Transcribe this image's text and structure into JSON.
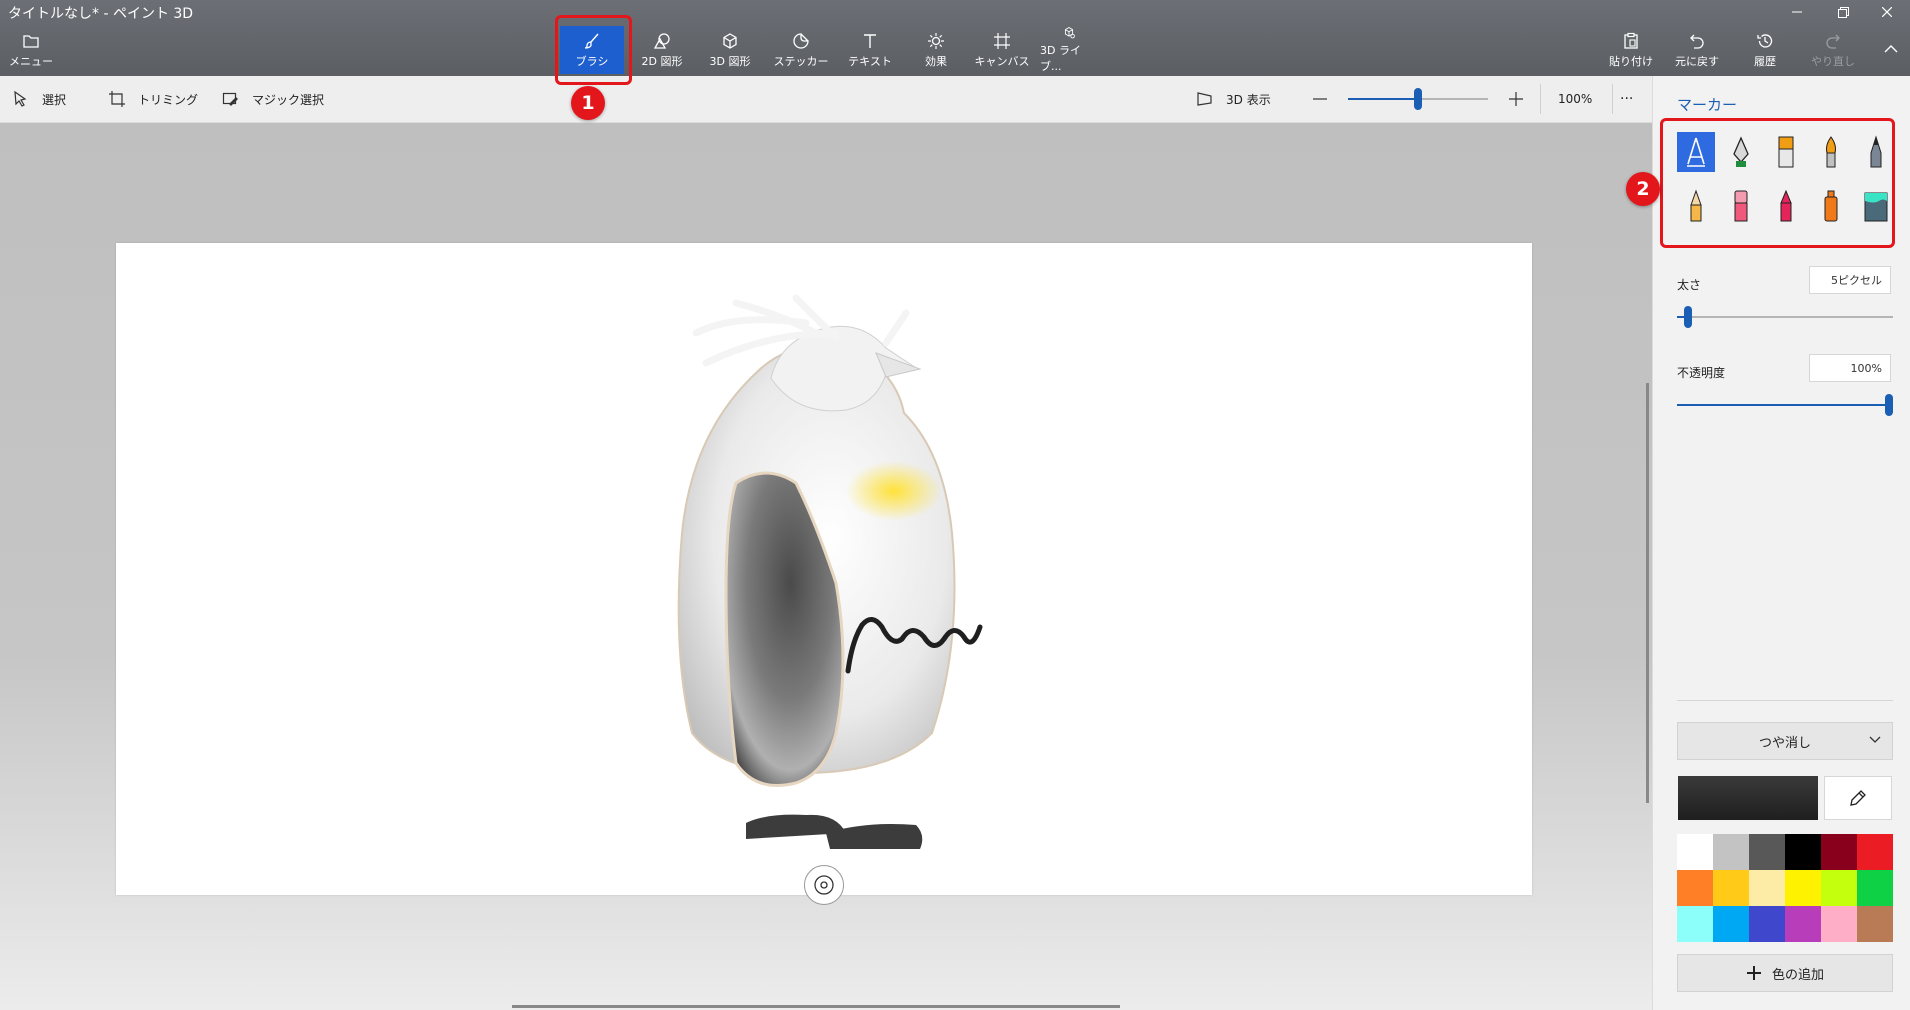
{
  "window": {
    "title": "タイトルなし* - ペイント 3D",
    "controls": [
      "minimize-icon",
      "restore-icon",
      "close-icon"
    ]
  },
  "ribbon": {
    "menu_label": "メニュー",
    "tools": [
      {
        "label": "ブラシ",
        "icon": "brush-icon",
        "active": true
      },
      {
        "label": "2D 図形",
        "icon": "2d-shapes-icon"
      },
      {
        "label": "3D 図形",
        "icon": "3d-shapes-icon"
      },
      {
        "label": "ステッカー",
        "icon": "stickers-icon"
      },
      {
        "label": "テキスト",
        "icon": "text-icon"
      },
      {
        "label": "効果",
        "icon": "effects-icon"
      },
      {
        "label": "キャンバス",
        "icon": "canvas-icon"
      },
      {
        "label": "3D ライブ...",
        "icon": "3d-library-icon"
      }
    ],
    "right": [
      {
        "label": "貼り付け",
        "icon": "paste-icon"
      },
      {
        "label": "元に戻す",
        "icon": "undo-icon"
      },
      {
        "label": "履歴",
        "icon": "history-icon"
      },
      {
        "label": "やり直し",
        "icon": "redo-icon",
        "disabled": true
      }
    ]
  },
  "subtoolbar": {
    "select": "選択",
    "crop": "トリミング",
    "magic_select": "マジック選択",
    "view3d": "3D 表示",
    "zoom": "100%",
    "zoom_level": 0.5,
    "more": "···"
  },
  "panel": {
    "title": "マーカー",
    "brushes": [
      "marker-icon",
      "calligraphy-pen-icon",
      "oil-brush-icon",
      "watercolor-icon",
      "pixel-pen-icon",
      "pencil-icon",
      "eraser-icon",
      "crayon-icon",
      "spray-can-icon",
      "fill-icon"
    ],
    "thickness_label": "太さ",
    "thickness_value": "5ピクセル",
    "thickness_level": 0.05,
    "opacity_label": "不透明度",
    "opacity_value": "100%",
    "opacity_level": 1.0,
    "finish": "つや消し",
    "current_color": "#1f1f1f",
    "palette": [
      "#ffffff",
      "#c3c3c3",
      "#585858",
      "#000000",
      "#88001b",
      "#ec1c24",
      "#ff7f27",
      "#ffca18",
      "#fdeca6",
      "#fff200",
      "#c4ff0e",
      "#0ed145",
      "#8cfffb",
      "#00a8f3",
      "#3f48cc",
      "#b83dba",
      "#ffaec8",
      "#b97a56"
    ],
    "add_color": "色の追加"
  },
  "annotations": {
    "badge1": "1",
    "badge2": "2"
  },
  "accent": "#1a5fb4"
}
